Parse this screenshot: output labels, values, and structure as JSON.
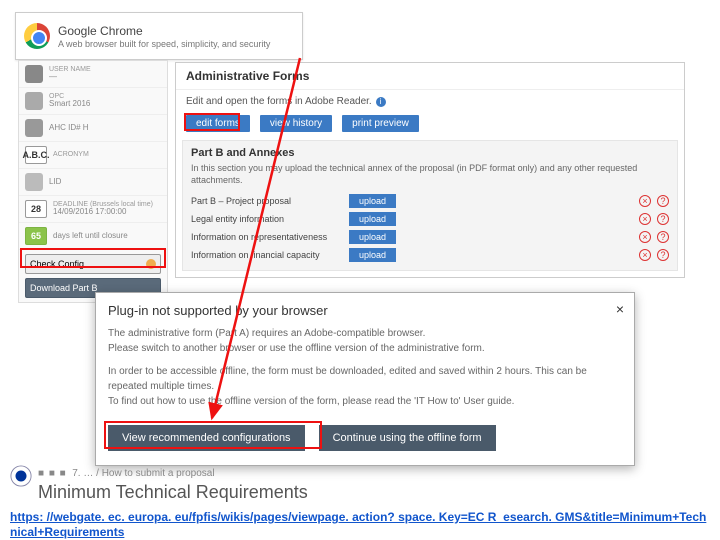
{
  "chrome": {
    "title": "Google Chrome",
    "subtitle": "A web browser built for speed, simplicity, and security"
  },
  "sidebar": {
    "user_name_label": "USER NAME",
    "user_name_value": "—",
    "opc_label": "OPC",
    "opc_value": "Smart 2016",
    "ahc_label": "AHC ID# H",
    "acronym_label": "ACRONYM",
    "abc": "A.B.C.",
    "lid_label": "LID",
    "deadline_label": "DEADLINE (Brussels local time)",
    "deadline_value": "14/09/2016 17:00:00",
    "deadline_box": "28",
    "daysleft_box": "65",
    "daysleft_text": "days left until closure",
    "check_config": "Check Config",
    "download_partb": "Download Part B"
  },
  "admin": {
    "title": "Administrative Forms",
    "edit_desc": "Edit and open the forms in Adobe Reader.",
    "edit_forms": "edit forms",
    "view_history": "view history",
    "print_preview": "print preview",
    "partb_title": "Part B and Annexes",
    "partb_desc": "In this section you may upload the technical annex of the proposal (in PDF format only) and any other requested attachments.",
    "rows": [
      {
        "label": "Part B – Project proposal",
        "btn": "upload"
      },
      {
        "label": "Legal entity information",
        "btn": "upload"
      },
      {
        "label": "Information on representativeness",
        "btn": "upload"
      },
      {
        "label": "Information on financial capacity",
        "btn": "upload"
      }
    ]
  },
  "modal": {
    "title": "Plug-in not supported by your browser",
    "p1": "The administrative form (Part A) requires an Adobe-compatible browser.",
    "p2": "Please switch to another browser or use the offline version of the administrative form.",
    "p3": "In order to be accessible offline, the form must be downloaded, edited and saved within 2 hours. This can be repeated multiple times.",
    "p4": "To find out how to use the offline version of the form, please read the 'IT How to' User guide.",
    "btn1": "View recommended configurations",
    "btn2": "Continue using the offline form"
  },
  "footer": {
    "breadcrumb": "7. … / How to submit a proposal",
    "title": "Minimum Technical Requirements",
    "link": "https: //webgate. ec. europa. eu/fpfis/wikis/pages/viewpage. action? space. Key=EC R_esearch. GMS&title=Minimum+Technical+Requirements"
  }
}
